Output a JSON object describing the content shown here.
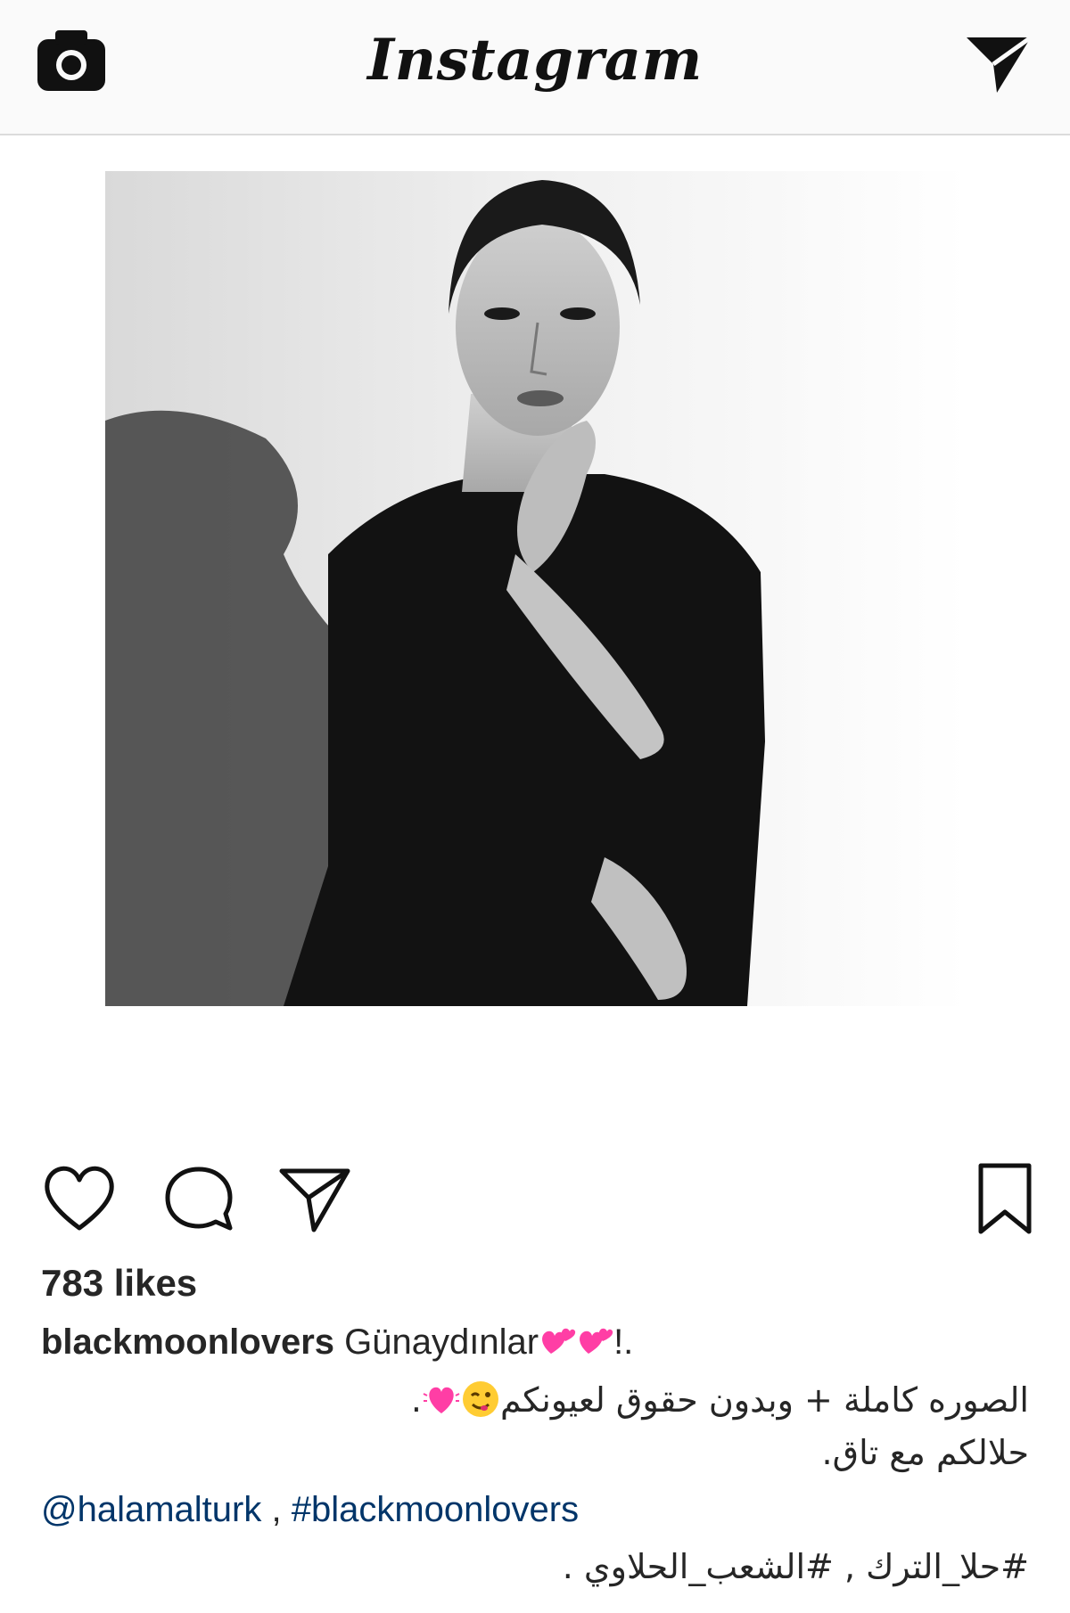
{
  "app": {
    "logo_text": "Instagram",
    "icons": {
      "camera": "camera-icon",
      "direct": "direct-message-icon"
    }
  },
  "post": {
    "photo_description_icon": "photo",
    "actions": {
      "like": "heart-icon",
      "comment": "comment-icon",
      "share": "share-icon",
      "save": "bookmark-icon"
    },
    "likes_text": "783 likes",
    "caption": {
      "username": "blackmoonlovers",
      "text_start": "Günaydınlar",
      "text_end": "!.",
      "line_ar_1": "الصوره كاملة + وبدون حقوق لعيونكم",
      "line_ar_1_end": ".",
      "line_ar_2": "حلالكم مع تاق.",
      "mention": "@halamalturk",
      "separator": " , ",
      "hashtag": "#blackmoonlovers",
      "line_ar_3": "#حلا_الترك , #الشعب_الحلاوي ."
    },
    "colors": {
      "link": "#003569",
      "text": "#262626",
      "heart_emoji": "#ff3ea5"
    }
  }
}
